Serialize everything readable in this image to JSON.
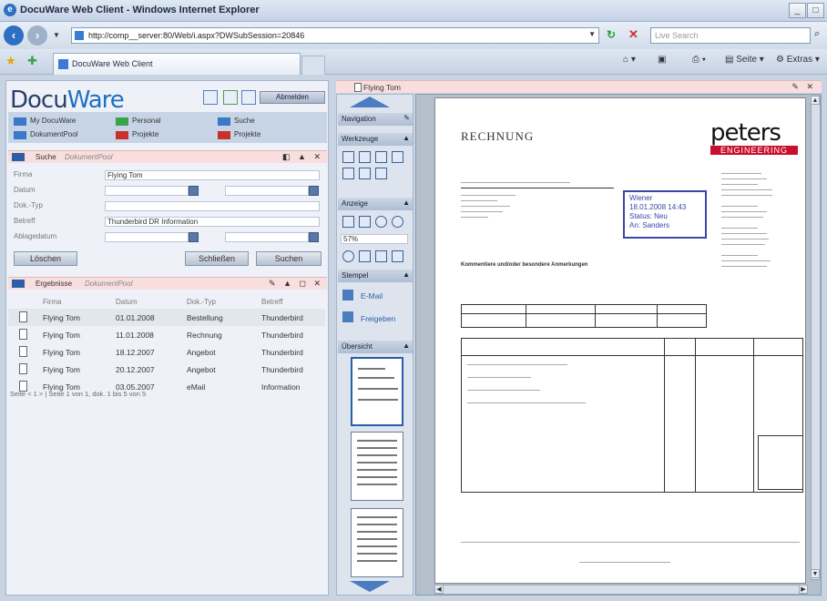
{
  "browser": {
    "title": "DocuWare Web Client - Windows Internet Explorer",
    "url": "http://comp__server:80/Web/i.aspx?DWSubSession=20846",
    "search_placeholder": "Live Search",
    "tab_label": "DocuWare Web Client",
    "toolbar_page": "Seite",
    "toolbar_extras": "Extras"
  },
  "app": {
    "logo_part1": "Docu",
    "logo_part2": "Ware",
    "logout_label": "Abmelden",
    "nav": [
      {
        "label": "My DocuWare",
        "color": "#3b78c8"
      },
      {
        "label": "Personal",
        "color": "#3aa34a"
      },
      {
        "label": "Suche",
        "color": "#3b78c8"
      },
      {
        "label": "DokumentPool",
        "color": "#3b78c8"
      },
      {
        "label": "Projekte",
        "color": "#c8302e"
      },
      {
        "label": "Projekte",
        "color": "#c8302e"
      }
    ]
  },
  "search_panel": {
    "title": "Suche",
    "subtitle": "DokumentPool",
    "fields": [
      {
        "label": "Firma",
        "value": "Flying Tom"
      },
      {
        "label": "Datum",
        "value": ""
      },
      {
        "label": "Dok.-Typ",
        "value": ""
      },
      {
        "label": "Betreff",
        "value": "Thunderbird DR Information"
      },
      {
        "label": "Ablagedatum",
        "value": ""
      }
    ],
    "btn_clear": "Löschen",
    "btn_close": "Schließen",
    "btn_search": "Suchen"
  },
  "results_panel": {
    "title": "Ergebnisse",
    "subtitle": "DokumentPool",
    "columns": [
      "Firma",
      "Datum",
      "Dok.-Typ",
      "Betreff"
    ],
    "rows": [
      [
        "Flying Tom",
        "01.01.2008",
        "Bestellung",
        "Thunderbird"
      ],
      [
        "Flying Tom",
        "11.01.2008",
        "Rechnung",
        "Thunderbird"
      ],
      [
        "Flying Tom",
        "18.12.2007",
        "Angebot",
        "Thunderbird"
      ],
      [
        "Flying Tom",
        "20.12.2007",
        "Angebot",
        "Thunderbird"
      ],
      [
        "Flying Tom",
        "03.05.2007",
        "eMail",
        "Information"
      ]
    ],
    "pager": "Seite < 1 > | Seite 1 von 1, dok. 1 bis 5 von 5"
  },
  "tools": {
    "sections": [
      "Navigation",
      "Werkzeuge",
      "Anzeige",
      "Stempel",
      "Übersicht"
    ],
    "zoom": "57%",
    "stamp_email": "E-Mail",
    "stamp_release": "Freigeben"
  },
  "viewer": {
    "title": "Flying Tom",
    "doc_heading": "RECHNUNG",
    "logo_top": "peters",
    "logo_bottom": "ENGINEERING",
    "stamp_lines": [
      "Wiener",
      "18.01.2008 14:43",
      "Status: Neu",
      "An: Sanders"
    ],
    "note": "Kommentiere und/oder besondere Anmerkungen"
  }
}
